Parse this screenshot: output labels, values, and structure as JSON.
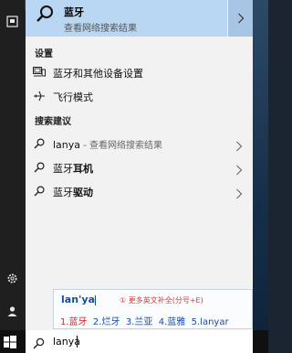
{
  "best_match": {
    "title": "蓝牙",
    "subtitle": "查看网络搜索结果"
  },
  "settings_section": {
    "header": "设置",
    "items": [
      {
        "label": "蓝牙和其他设备设置"
      },
      {
        "label": "飞行模式"
      }
    ]
  },
  "suggestions_section": {
    "header": "搜索建议",
    "items": [
      {
        "query": "lanya",
        "suffix": " - 查看网络搜索结果"
      },
      {
        "query_prefix": "蓝牙",
        "query_bold": "耳机"
      },
      {
        "query_prefix": "蓝牙",
        "query_bold": "驱动"
      }
    ]
  },
  "ime": {
    "composition": "lan'ya",
    "hint": "① 更多英文补全(分号+E)",
    "candidates": [
      "1.蓝牙",
      "2.烂牙",
      "3.兰亚",
      "4.蓝雅",
      "5.lanyar"
    ]
  },
  "search": {
    "value": "lanya"
  },
  "colors": {
    "highlight": "#b9d6f2",
    "ime_text": "#1a4aa8",
    "ime_hint": "#d03a3a"
  }
}
